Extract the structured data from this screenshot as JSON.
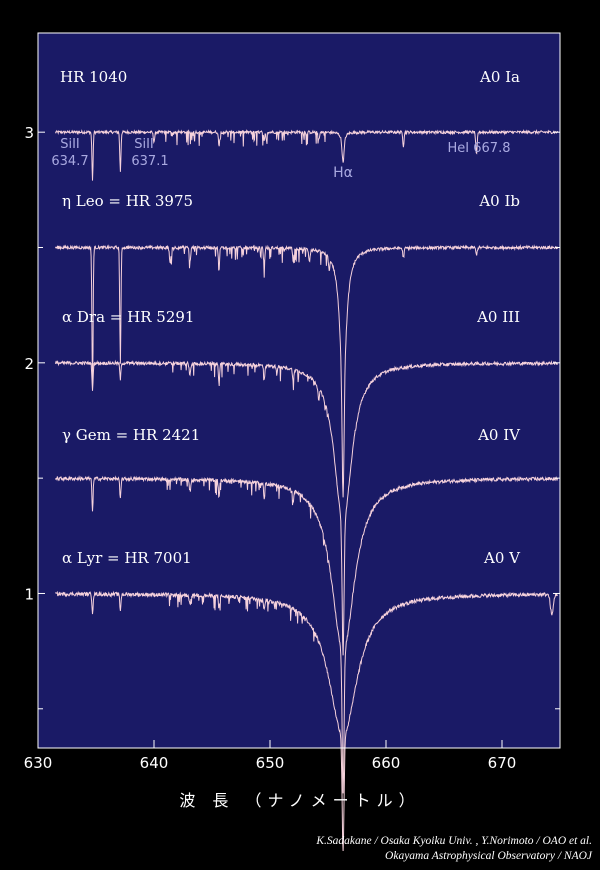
{
  "colors": {
    "background": "#000000",
    "plot_background": "#1a1a66",
    "spectrum": "#f6d2dc",
    "text": "#ffffff",
    "line_label": "#a9a9e0"
  },
  "chart_data": {
    "type": "line",
    "xlabel": "波 長 （ナノメートル）",
    "xlim": [
      630,
      675
    ],
    "ylim": [
      0.33,
      3.43
    ],
    "x_ticks": [
      630,
      640,
      650,
      660,
      670
    ],
    "y_ticks": [
      1,
      2,
      3
    ],
    "y_ticks_minor": [
      0.5,
      1.5,
      2.5
    ],
    "series": [
      {
        "name": "HR 1040",
        "spectral_type": "A0 Ia",
        "continuum": 3.0,
        "halpha_depth": 0.13,
        "halpha_wing": 0.15,
        "lines": [
          [
            634.7,
            0.21,
            0.05
          ],
          [
            637.1,
            0.17,
            0.05
          ],
          [
            640.0,
            0.04,
            0.06
          ],
          [
            645.6,
            0.06,
            0.05
          ],
          [
            649.5,
            0.04,
            0.05
          ],
          [
            654.2,
            0.03,
            0.06
          ],
          [
            661.5,
            0.06,
            0.05
          ],
          [
            667.8,
            0.1,
            0.06
          ]
        ]
      },
      {
        "name": "η Leo = HR 3975",
        "spectral_type": "A0 Ib",
        "continuum": 2.5,
        "halpha_depth": 1.08,
        "halpha_wing": 0.35,
        "lines": [
          [
            634.7,
            0.62,
            0.05
          ],
          [
            637.1,
            0.5,
            0.05
          ],
          [
            641.4,
            0.07,
            0.06
          ],
          [
            643.1,
            0.06,
            0.06
          ],
          [
            645.6,
            0.1,
            0.05
          ],
          [
            649.5,
            0.08,
            0.05
          ],
          [
            652.0,
            0.06,
            0.05
          ],
          [
            653.4,
            0.05,
            0.06
          ],
          [
            655.1,
            0.05,
            0.06
          ],
          [
            661.5,
            0.04,
            0.06
          ],
          [
            667.8,
            0.03,
            0.06
          ]
        ]
      },
      {
        "name": "α Dra = HR 5291",
        "spectral_type": "A0 III",
        "continuum": 2.0,
        "halpha_depth": 1.27,
        "halpha_wing": 0.9,
        "lines": [
          [
            634.7,
            0.12,
            0.05
          ],
          [
            637.1,
            0.07,
            0.05
          ],
          [
            643.1,
            0.05,
            0.06
          ],
          [
            645.6,
            0.08,
            0.05
          ],
          [
            649.5,
            0.06,
            0.05
          ],
          [
            652.0,
            0.05,
            0.05
          ],
          [
            654.2,
            0.05,
            0.06
          ]
        ]
      },
      {
        "name": "γ Gem = HR 2421",
        "spectral_type": "A0 IV",
        "continuum": 1.5,
        "halpha_depth": 1.37,
        "halpha_wing": 1.2,
        "lines": [
          [
            634.7,
            0.14,
            0.05
          ],
          [
            637.1,
            0.09,
            0.05
          ],
          [
            643.1,
            0.05,
            0.06
          ],
          [
            645.6,
            0.08,
            0.05
          ],
          [
            649.5,
            0.07,
            0.05
          ],
          [
            652.0,
            0.05,
            0.05
          ]
        ]
      },
      {
        "name": "α Lyr = HR 7001",
        "spectral_type": "A0 V",
        "continuum": 1.0,
        "halpha_depth": 1.12,
        "halpha_wing": 1.5,
        "lines": [
          [
            634.7,
            0.08,
            0.05
          ],
          [
            637.1,
            0.07,
            0.05
          ],
          [
            643.1,
            0.04,
            0.06
          ],
          [
            645.6,
            0.05,
            0.05
          ],
          [
            649.5,
            0.04,
            0.05
          ],
          [
            674.3,
            0.09,
            0.12
          ]
        ]
      }
    ],
    "annotations": [
      {
        "label": "SiII",
        "sub": "634.7"
      },
      {
        "label": "SiII",
        "sub": "637.1"
      },
      {
        "label": "Hα"
      },
      {
        "label": "HeI 667.8"
      }
    ]
  },
  "credit": {
    "line1": "K.Sadakane / Osaka Kyoiku Univ. , Y.Norimoto / OAO et al.",
    "line2": "Okayama Astrophysical Observatory / NAOJ"
  }
}
